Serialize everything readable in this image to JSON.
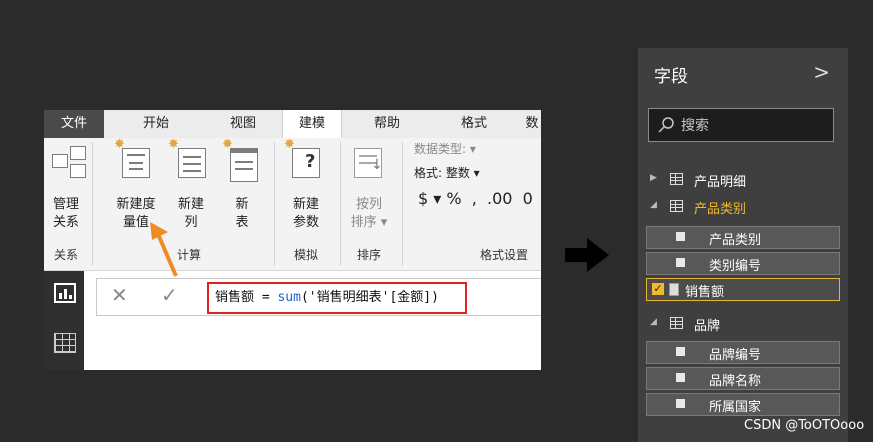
{
  "ribbon": {
    "tabs": [
      "文件",
      "开始",
      "视图",
      "建模",
      "帮助",
      "格式",
      "数"
    ],
    "groups": {
      "relation": "关系",
      "calc": "计算",
      "whatif": "模拟",
      "sort": "排序",
      "format": "格式设置"
    },
    "buttons": {
      "manage_rel": "管理\n关系",
      "new_measure": "新建度\n量值",
      "new_column": "新建\n列",
      "new_table": "新\n表",
      "new_param": "新建\n参数",
      "sort_by": "按列\n排序 ▾"
    },
    "format": {
      "data_type": "数据类型: ▾",
      "format": "格式: 整数 ▾",
      "symbols": "$ ▾ %  ,  .00  0"
    },
    "formula": {
      "cancel_glyph": "✕",
      "commit_glyph": "✓",
      "prefix": "销售额 = ",
      "fn": "sum",
      "suffix": "('销售明细表'[金额])"
    }
  },
  "fields_pane": {
    "title": "字段",
    "collapse_glyph": ">",
    "search_placeholder": "搜索",
    "tables": [
      {
        "name": "产品明细",
        "expanded": false
      },
      {
        "name": "产品类别",
        "expanded": true,
        "highlight_color": "#f2b92e",
        "fields": [
          "产品类别",
          "类别编号",
          "销售额"
        ],
        "selected": "销售额"
      },
      {
        "name": "品牌",
        "expanded": true,
        "fields": [
          "品牌编号",
          "品牌名称",
          "所属国家"
        ]
      }
    ]
  },
  "watermark": "CSDN @ToOTOooo",
  "colors": {
    "accent": "#f2b92e",
    "formula_box": "#e0211d",
    "arrow": "#f08a24"
  }
}
